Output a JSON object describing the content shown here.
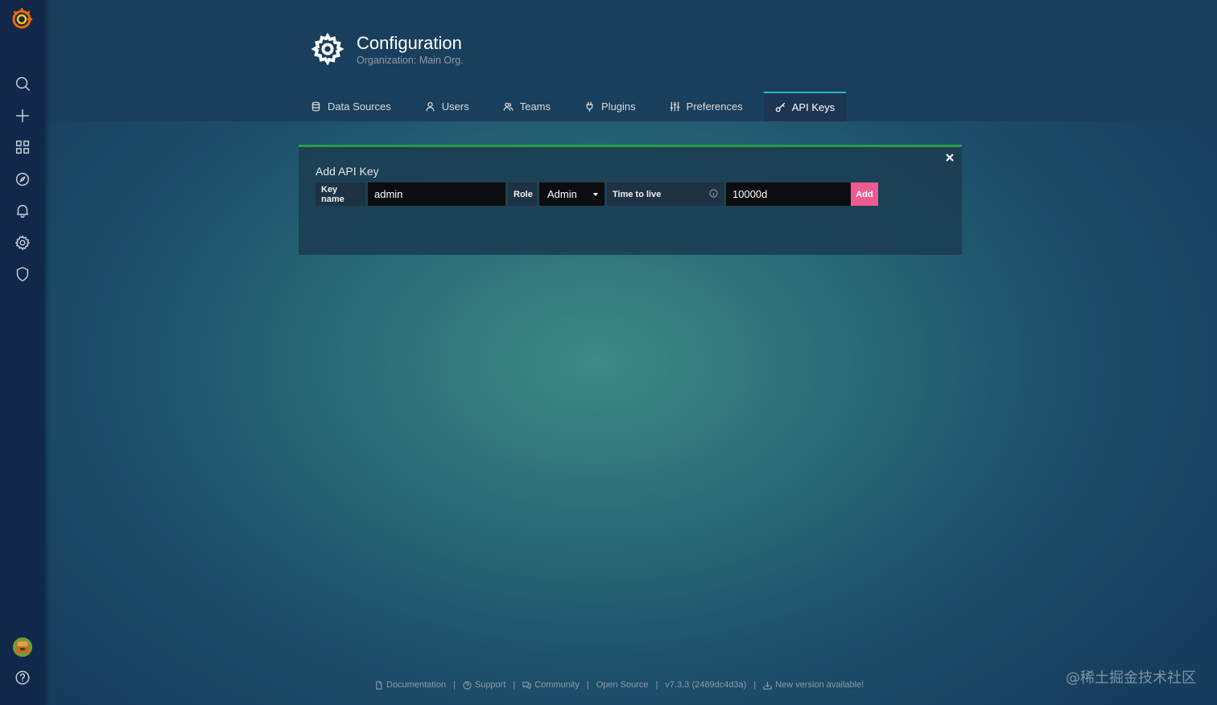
{
  "header": {
    "title": "Configuration",
    "subtitle": "Organization: Main Org."
  },
  "tabs": [
    {
      "label": "Data Sources",
      "icon": "database-icon"
    },
    {
      "label": "Users",
      "icon": "user-icon"
    },
    {
      "label": "Teams",
      "icon": "users-icon"
    },
    {
      "label": "Plugins",
      "icon": "plug-icon"
    },
    {
      "label": "Preferences",
      "icon": "sliders-icon"
    },
    {
      "label": "API Keys",
      "icon": "key-icon",
      "active": true
    }
  ],
  "sidebar": {
    "items": [
      "search-icon",
      "plus-icon",
      "dashboards-icon",
      "explore-icon",
      "bell-icon",
      "gear-icon",
      "shield-icon"
    ],
    "bottom": [
      "avatar",
      "help-icon"
    ]
  },
  "panel": {
    "title": "Add API Key",
    "key_name_label": "Key name",
    "key_name_value": "admin",
    "role_label": "Role",
    "role_value": "Admin",
    "ttl_label": "Time to live",
    "ttl_value": "10000d",
    "add_label": "Add"
  },
  "footer": {
    "documentation": "Documentation",
    "support": "Support",
    "community": "Community",
    "open_source": "Open Source",
    "version": "v7.3.3 (2489dc4d3a)",
    "new_version": "New version available!"
  },
  "watermark": "@稀土掘金技术社区",
  "colors": {
    "accent": "#29b6c6",
    "panel_border": "#299c46",
    "add_button": "#f05a90",
    "sidebar": "#12284a"
  }
}
